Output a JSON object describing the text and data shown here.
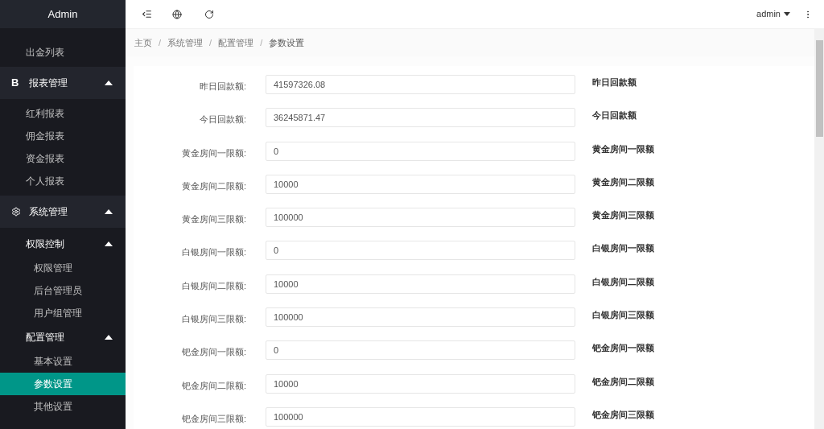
{
  "sidebar": {
    "title": "Admin",
    "items": [
      {
        "label": "出金列表",
        "selected": false
      },
      {
        "label": "报表管理",
        "kind": "letter",
        "icon": "B",
        "expanded": true,
        "children": [
          {
            "label": "红利报表",
            "selected": false
          },
          {
            "label": "佣金报表",
            "selected": false
          },
          {
            "label": "资金报表",
            "selected": false
          },
          {
            "label": "个人报表",
            "selected": false
          }
        ]
      },
      {
        "label": "系统管理",
        "kind": "gear",
        "expanded": true,
        "children": [
          {
            "label": "权限控制",
            "expanded": true,
            "children": [
              {
                "label": "权限管理",
                "selected": false
              },
              {
                "label": "后台管理员",
                "selected": false
              },
              {
                "label": "用户组管理",
                "selected": false
              }
            ]
          },
          {
            "label": "配置管理",
            "expanded": true,
            "children": [
              {
                "label": "基本设置",
                "selected": false
              },
              {
                "label": "参数设置",
                "selected": true
              },
              {
                "label": "其他设置",
                "selected": false
              }
            ]
          }
        ]
      }
    ]
  },
  "topbar": {
    "user": "admin"
  },
  "breadcrumb": [
    {
      "label": "主页"
    },
    {
      "separator": "/",
      "label": "系统管理"
    },
    {
      "separator": "/",
      "label": "配置管理"
    },
    {
      "separator": "/",
      "label": "参数设置"
    }
  ],
  "form": [
    {
      "label": "昨日回款额:",
      "value": "41597326.08",
      "hint": "昨日回款额"
    },
    {
      "label": "今日回款额:",
      "value": "36245871.47",
      "hint": "今日回款额"
    },
    {
      "label": "黄金房间一限额:",
      "value": "0",
      "hint": "黄金房间一限额"
    },
    {
      "label": "黄金房间二限额:",
      "value": "10000",
      "hint": "黄金房间二限额"
    },
    {
      "label": "黄金房间三限额:",
      "value": "100000",
      "hint": "黄金房间三限额"
    },
    {
      "label": "白银房间一限额:",
      "value": "0",
      "hint": "白银房间一限额"
    },
    {
      "label": "白银房间二限额:",
      "value": "10000",
      "hint": "白银房间二限额"
    },
    {
      "label": "白银房间三限额:",
      "value": "100000",
      "hint": "白银房间三限额"
    },
    {
      "label": "钯金房间一限额:",
      "value": "0",
      "hint": "钯金房间一限额"
    },
    {
      "label": "钯金房间二限额:",
      "value": "10000",
      "hint": "钯金房间二限额"
    },
    {
      "label": "钯金房间三限额:",
      "value": "100000",
      "hint": "钯金房间三限额"
    }
  ]
}
